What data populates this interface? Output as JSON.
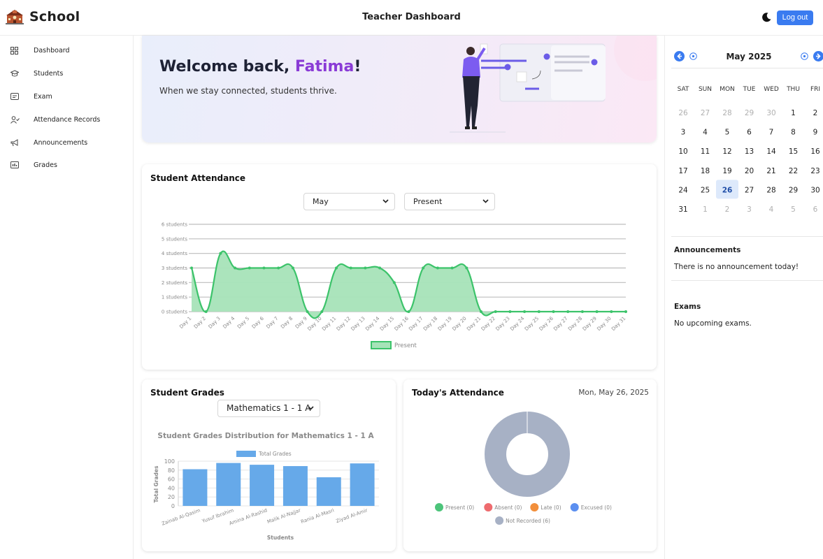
{
  "app": {
    "name": "School",
    "page_title": "Teacher Dashboard",
    "logout_label": "Log out"
  },
  "sidebar": {
    "items": [
      {
        "label": "Dashboard",
        "icon": "grid-icon"
      },
      {
        "label": "Students",
        "icon": "graduation-cap-icon"
      },
      {
        "label": "Exam",
        "icon": "exam-card-icon"
      },
      {
        "label": "Attendance Records",
        "icon": "user-check-icon"
      },
      {
        "label": "Announcements",
        "icon": "megaphone-icon"
      },
      {
        "label": "Grades",
        "icon": "grades-chart-icon"
      }
    ]
  },
  "banner": {
    "greeting": "Welcome back, ",
    "name": "Fatima",
    "exclaim": "!",
    "tagline": "When we stay connected, students thrive."
  },
  "attendance": {
    "title": "Student Attendance",
    "month_select": "May",
    "status_select": "Present"
  },
  "grades": {
    "title": "Student Grades",
    "course_select": "Mathematics 1 - 1 A"
  },
  "today": {
    "title": "Today's Attendance",
    "date": "Mon, May 26, 2025"
  },
  "calendar": {
    "month_label": "May 2025",
    "weekdays": [
      "SAT",
      "SUN",
      "MON",
      "TUE",
      "WED",
      "THU",
      "FRI"
    ],
    "weeks": [
      [
        [
          "26",
          0
        ],
        [
          "27",
          0
        ],
        [
          "28",
          0
        ],
        [
          "29",
          0
        ],
        [
          "30",
          0
        ],
        [
          "1",
          1
        ],
        [
          "2",
          1
        ]
      ],
      [
        [
          "3",
          1
        ],
        [
          "4",
          1
        ],
        [
          "5",
          1
        ],
        [
          "6",
          1
        ],
        [
          "7",
          1
        ],
        [
          "8",
          1
        ],
        [
          "9",
          1
        ]
      ],
      [
        [
          "10",
          1
        ],
        [
          "11",
          1
        ],
        [
          "12",
          1
        ],
        [
          "13",
          1
        ],
        [
          "14",
          1
        ],
        [
          "15",
          1
        ],
        [
          "16",
          1
        ]
      ],
      [
        [
          "17",
          1
        ],
        [
          "18",
          1
        ],
        [
          "19",
          1
        ],
        [
          "20",
          1
        ],
        [
          "21",
          1
        ],
        [
          "22",
          1
        ],
        [
          "23",
          1
        ]
      ],
      [
        [
          "24",
          1
        ],
        [
          "25",
          1
        ],
        [
          "26",
          2
        ],
        [
          "27",
          1
        ],
        [
          "28",
          1
        ],
        [
          "29",
          1
        ],
        [
          "30",
          1
        ]
      ],
      [
        [
          "31",
          1
        ],
        [
          "1",
          0
        ],
        [
          "2",
          0
        ],
        [
          "3",
          0
        ],
        [
          "4",
          0
        ],
        [
          "5",
          0
        ],
        [
          "6",
          0
        ]
      ]
    ]
  },
  "announcements": {
    "title": "Announcements",
    "text": "There is no announcement today!"
  },
  "exams": {
    "title": "Exams",
    "text": "No upcoming exams."
  },
  "chart_data": [
    {
      "type": "area",
      "title": "",
      "x": [
        "Day 1",
        "Day 2",
        "Day 3",
        "Day 4",
        "Day 5",
        "Day 6",
        "Day 7",
        "Day 8",
        "Day 9",
        "Day 10",
        "Day 11",
        "Day 12",
        "Day 13",
        "Day 14",
        "Day 15",
        "Day 16",
        "Day 17",
        "Day 18",
        "Day 19",
        "Day 20",
        "Day 21",
        "Day 22",
        "Day 23",
        "Day 24",
        "Day 25",
        "Day 26",
        "Day 27",
        "Day 28",
        "Day 29",
        "Day 30",
        "Day 31"
      ],
      "series": [
        {
          "name": "Present",
          "values": [
            3,
            0,
            4,
            3,
            3,
            3,
            3,
            3,
            0,
            0,
            3,
            3,
            3,
            3,
            2,
            0,
            3,
            3,
            3,
            3,
            0,
            0,
            0,
            0,
            0,
            0,
            0,
            0,
            0,
            0,
            0
          ]
        }
      ],
      "yticks": [
        "0 students",
        "1 students",
        "2 students",
        "3 students",
        "4 students",
        "5 students",
        "6 students"
      ],
      "ylim": [
        0,
        6
      ],
      "grid": true,
      "legend": "bottom",
      "color": "#3cc36a"
    },
    {
      "type": "bar",
      "title": "Student Grades Distribution for Mathematics 1 - 1 A",
      "categories": [
        "Zainab Al-Qasim",
        "Yusuf Ibrahim",
        "Amina Al-Rashid",
        "Malik Al-Najjar",
        "Rania Al-Masri",
        "Ziyad Al-Amir"
      ],
      "series": [
        {
          "name": "Total Grades",
          "values": [
            82,
            96,
            92,
            89,
            64,
            95
          ]
        }
      ],
      "xlabel": "Students",
      "ylabel": "Total Grades",
      "ylim": [
        0,
        100
      ],
      "yticks": [
        "0",
        "20",
        "40",
        "60",
        "80",
        "100"
      ],
      "legend": "top",
      "color": "#66a9e9"
    },
    {
      "type": "pie",
      "title": "",
      "categories": [
        "Present (0)",
        "Absent (0)",
        "Late (0)",
        "Excused (0)",
        "Not Recorded (6)"
      ],
      "values": [
        0,
        0,
        0,
        0,
        6
      ],
      "colors": [
        "#4cc47a",
        "#ee6b6e",
        "#f28f3b",
        "#5b8ff0",
        "#a7b1c5"
      ],
      "legend": "bottom"
    }
  ]
}
